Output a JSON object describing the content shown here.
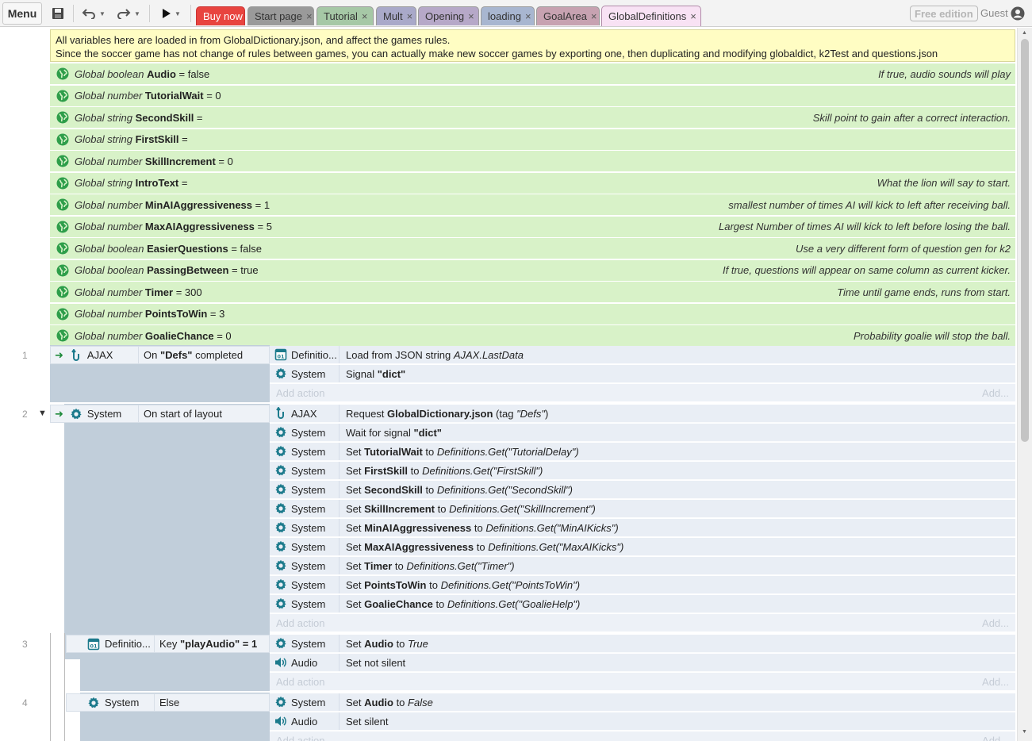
{
  "toolbar": {
    "menu_label": "Menu",
    "tabs": [
      {
        "label": "Buy now"
      },
      {
        "label": "Start page"
      },
      {
        "label": "Tutorial"
      },
      {
        "label": "Mult"
      },
      {
        "label": "Opening"
      },
      {
        "label": "loading"
      },
      {
        "label": "GoalArea"
      },
      {
        "label": "GlobalDefinitions"
      }
    ],
    "close_glyph": "×",
    "free_edition": "Free edition",
    "user": "Guest"
  },
  "comment": {
    "line1": "All variables here are loaded in from GlobalDictionary.json, and affect the games rules.",
    "line2": "Since the soccer game has not change of rules between games, you can actually make new soccer games by exporting one, then duplicating and modifying globaldict, k2Test and questions.json"
  },
  "globals": [
    {
      "kw": "Global boolean",
      "name": "Audio",
      "rest": " = false",
      "comment": "If true, audio sounds will play"
    },
    {
      "kw": "Global number",
      "name": "TutorialWait",
      "rest": " = 0",
      "comment": ""
    },
    {
      "kw": "Global string",
      "name": "SecondSkill",
      "rest": " =",
      "comment": "Skill point to gain after a correct interaction."
    },
    {
      "kw": "Global string",
      "name": "FirstSkill",
      "rest": " =",
      "comment": ""
    },
    {
      "kw": "Global number",
      "name": "SkillIncrement",
      "rest": " = 0",
      "comment": ""
    },
    {
      "kw": "Global string",
      "name": "IntroText",
      "rest": " =",
      "comment": "What the lion will say to start."
    },
    {
      "kw": "Global number",
      "name": "MinAIAggressiveness",
      "rest": " = 1",
      "comment": "smallest number of times AI will kick to left after receiving ball."
    },
    {
      "kw": "Global number",
      "name": "MaxAIAggressiveness",
      "rest": " = 5",
      "comment": "Largest Number of times AI will kick to left before losing the ball."
    },
    {
      "kw": "Global boolean",
      "name": "EasierQuestions",
      "rest": " = false",
      "comment": "Use a very different form of question gen for k2"
    },
    {
      "kw": "Global boolean",
      "name": "PassingBetween",
      "rest": " = true",
      "comment": "If true, questions will appear on same column as current kicker."
    },
    {
      "kw": "Global number",
      "name": "Timer",
      "rest": " = 300",
      "comment": "Time until game ends, runs from start."
    },
    {
      "kw": "Global number",
      "name": "PointsToWin",
      "rest": " = 3",
      "comment": ""
    },
    {
      "kw": "Global number",
      "name": "GoalieChance",
      "rest": " = 0",
      "comment": "Probability goalie will stop the ball."
    }
  ],
  "events": {
    "e1": {
      "num": "1",
      "cond_obj": "AJAX",
      "cond_pre": "On ",
      "cond_bold": "\"Defs\"",
      "cond_post": " completed",
      "actions": [
        {
          "obj": "Definitio...",
          "pre": "Load from JSON string ",
          "ital": "AJAX.LastData"
        },
        {
          "obj": "System",
          "pre": "Signal ",
          "bold": "\"dict\""
        }
      ]
    },
    "e2": {
      "num": "2",
      "toggle": "▼",
      "cond_obj": "System",
      "cond_text": "On start of layout",
      "actions": [
        {
          "obj": "AJAX",
          "pre": "Request ",
          "bold": "GlobalDictionary.json",
          "post": " (tag ",
          "ital": "\"Defs\"",
          "post2": ")"
        },
        {
          "obj": "System",
          "pre": "Wait for signal ",
          "bold": "\"dict\""
        },
        {
          "obj": "System",
          "pre": "Set ",
          "bold": "TutorialWait",
          "post": " to ",
          "ital": "Definitions.Get(\"TutorialDelay\")"
        },
        {
          "obj": "System",
          "pre": "Set ",
          "bold": "FirstSkill",
          "post": " to ",
          "ital": "Definitions.Get(\"FirstSkill\")"
        },
        {
          "obj": "System",
          "pre": "Set ",
          "bold": "SecondSkill",
          "post": " to ",
          "ital": "Definitions.Get(\"SecondSkill\")"
        },
        {
          "obj": "System",
          "pre": "Set ",
          "bold": "SkillIncrement",
          "post": " to ",
          "ital": "Definitions.Get(\"SkillIncrement\")"
        },
        {
          "obj": "System",
          "pre": "Set ",
          "bold": "MinAIAggressiveness",
          "post": " to ",
          "ital": "Definitions.Get(\"MinAIKicks\")"
        },
        {
          "obj": "System",
          "pre": "Set ",
          "bold": "MaxAIAggressiveness",
          "post": " to ",
          "ital": "Definitions.Get(\"MaxAIKicks\")"
        },
        {
          "obj": "System",
          "pre": "Set ",
          "bold": "Timer",
          "post": " to ",
          "ital": "Definitions.Get(\"Timer\")"
        },
        {
          "obj": "System",
          "pre": "Set ",
          "bold": "PointsToWin",
          "post": " to ",
          "ital": "Definitions.Get(\"PointsToWin\")"
        },
        {
          "obj": "System",
          "pre": "Set ",
          "bold": "GoalieChance",
          "post": " to ",
          "ital": "Definitions.Get(\"GoalieHelp\")"
        }
      ]
    },
    "e3": {
      "num": "3",
      "cond_obj": "Definitio...",
      "cond_pre": "Key ",
      "cond_bold": "\"playAudio\" = 1",
      "actions": [
        {
          "obj": "System",
          "pre": "Set ",
          "bold": "Audio",
          "post": " to ",
          "ital": "True"
        },
        {
          "obj": "Audio",
          "pre": "Set not silent"
        }
      ]
    },
    "e4": {
      "num": "4",
      "cond_obj": "System",
      "cond_text": "Else",
      "actions": [
        {
          "obj": "System",
          "pre": "Set ",
          "bold": "Audio",
          "post": " to ",
          "ital": "False"
        },
        {
          "obj": "Audio",
          "pre": "Set silent"
        }
      ]
    },
    "add_action": "Add action",
    "add_more": "Add..."
  },
  "colors": {
    "buy_now": "#e8443f",
    "global_var_bg": "#d8f2c8",
    "comment_bg": "#fffdc3",
    "event_block": "#c1ceda",
    "icon_teal": "#1c7a8c"
  }
}
